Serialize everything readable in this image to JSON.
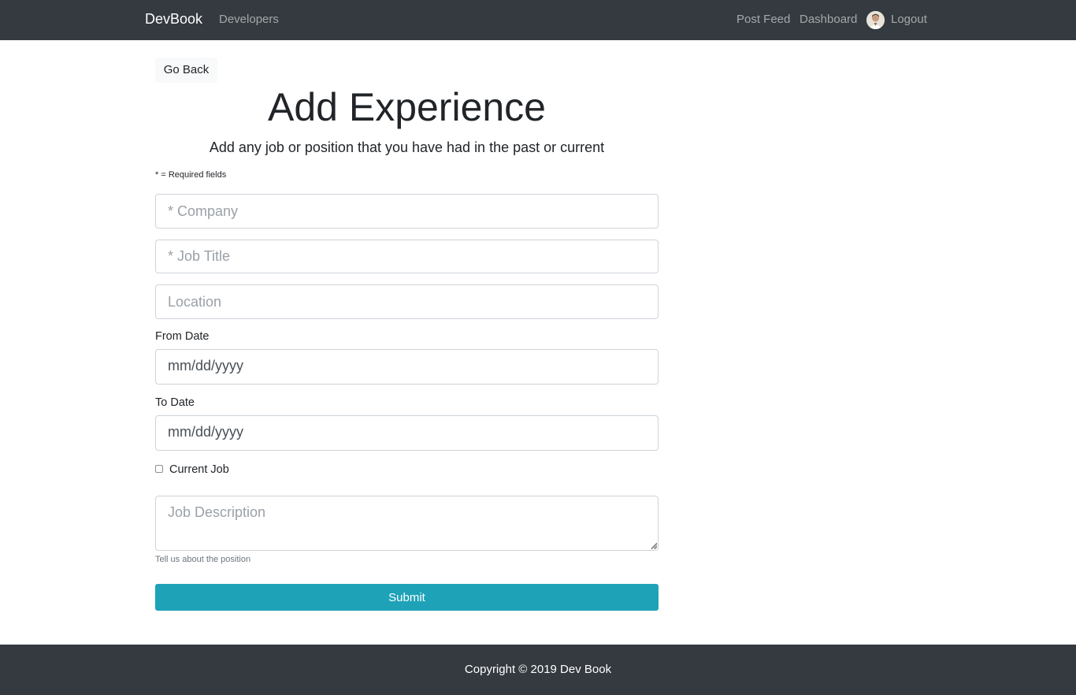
{
  "navbar": {
    "brand": "DevBook",
    "developers": "Developers",
    "post_feed": "Post Feed",
    "dashboard": "Dashboard",
    "logout": "Logout"
  },
  "page": {
    "go_back": "Go Back",
    "title": "Add Experience",
    "lead": "Add any job or position that you have had in the past or current",
    "required_note": "* = Required fields"
  },
  "form": {
    "company_placeholder": "* Company",
    "job_title_placeholder": "* Job Title",
    "location_placeholder": "Location",
    "from_label": "From Date",
    "from_value": "mm/dd/yyyy",
    "to_label": "To Date",
    "to_value": "mm/dd/yyyy",
    "current_job_label": "Current Job",
    "current_job_checked": false,
    "description_placeholder": "Job Description",
    "description_help": "Tell us about the position",
    "submit_label": "Submit"
  },
  "footer": {
    "copyright": "Copyright © 2019 Dev Book"
  },
  "colors": {
    "navbar_bg": "#343a40",
    "submit_bg": "#1ea2b8",
    "footer_bg": "#343a40"
  }
}
